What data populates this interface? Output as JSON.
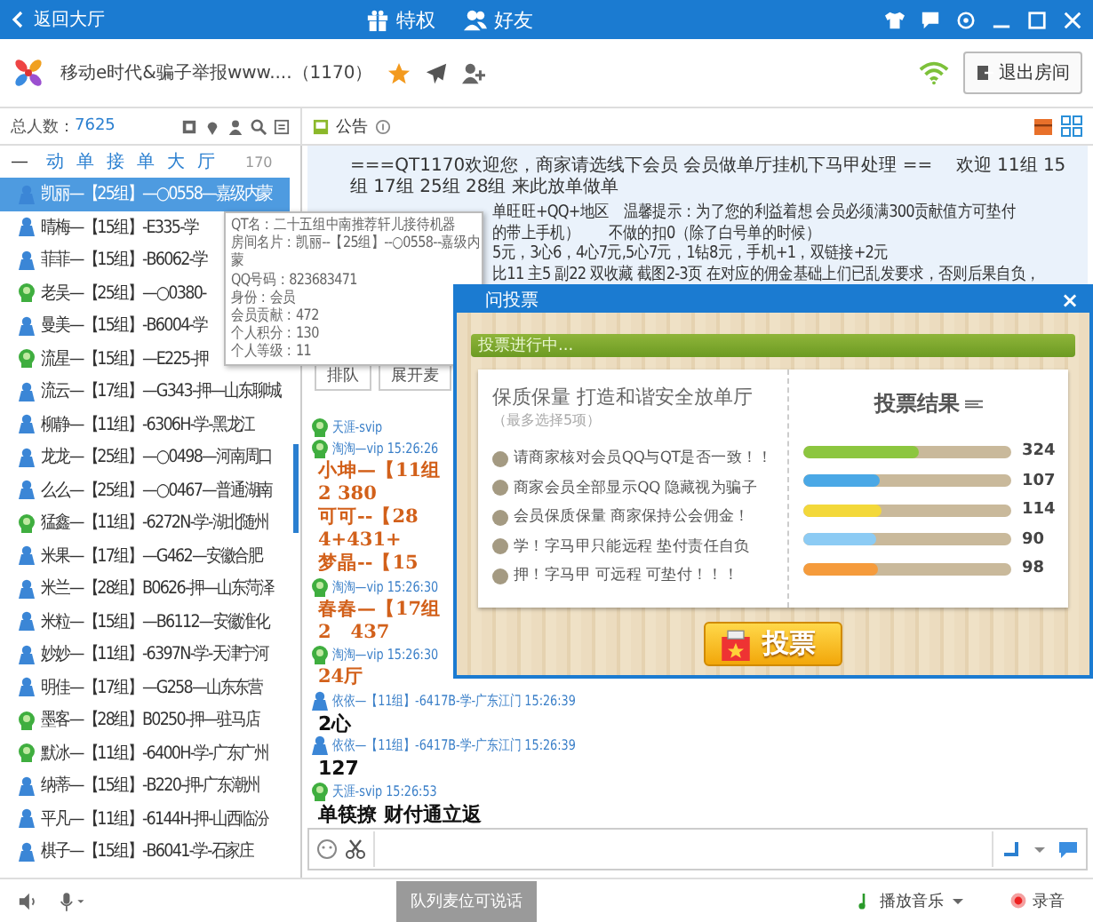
{
  "titlebar": {
    "back": "返回大厅",
    "tabs": [
      {
        "label": "特权",
        "kind": "gift"
      },
      {
        "label": "好友",
        "kind": "friends"
      }
    ]
  },
  "room": {
    "name": "移动e时代&骗子举报www....（1170）",
    "exit": "退出房间"
  },
  "info": {
    "total_label": "总人数：",
    "total": "7625",
    "notice": "公告"
  },
  "userlist": {
    "collapse": "—",
    "title": "动单接单大厅",
    "count": "170",
    "users": [
      {
        "name": "凯丽—【25组】—○0558—嘉级内蒙",
        "kind": "member",
        "selected": true
      },
      {
        "name": "晴梅—【15组】-E335-学",
        "kind": "member",
        "selected": false
      },
      {
        "name": "菲菲—【15组】-B6062-学",
        "kind": "member",
        "selected": false
      },
      {
        "name": "老吴—【25组】—○0380-",
        "kind": "vip",
        "selected": false
      },
      {
        "name": "曼美—【15组】-B6004-学",
        "kind": "member",
        "selected": false
      },
      {
        "name": "流星—【15组】—E225-押",
        "kind": "vip",
        "selected": false
      },
      {
        "name": "流云—【17组】—G343-押—山东聊城",
        "kind": "member",
        "selected": false
      },
      {
        "name": "柳静—【11组】-6306H-学-黑龙江",
        "kind": "member",
        "selected": false
      },
      {
        "name": "龙龙—【25组】—○0498—河南周口",
        "kind": "member",
        "selected": false
      },
      {
        "name": "么么—【25组】—○0467—普通湖南",
        "kind": "member",
        "selected": false
      },
      {
        "name": "猛鑫—【11组】-6272N-学-湖北随州",
        "kind": "vip",
        "selected": false
      },
      {
        "name": "米果—【17组】—G462—安徽合肥",
        "kind": "member",
        "selected": false
      },
      {
        "name": "米兰—【28组】B0626-押—山东菏泽",
        "kind": "member",
        "selected": false
      },
      {
        "name": "米粒—【15组】—B6112—安徽淮化",
        "kind": "member",
        "selected": false
      },
      {
        "name": "妙妙—【11组】-6397N-学-天津宁河",
        "kind": "member",
        "selected": false
      },
      {
        "name": "明佳—【17组】—G258—山东东营",
        "kind": "member",
        "selected": false
      },
      {
        "name": "墨客—【28组】B0250-押—驻马店",
        "kind": "vip",
        "selected": false
      },
      {
        "name": "默冰—【11组】-6400H-学-广东广州",
        "kind": "vip",
        "selected": false
      },
      {
        "name": "纳蒂—【15组】-B220-押-广东潮州",
        "kind": "member",
        "selected": false
      },
      {
        "name": "平凡—【11组】-6144H-押-山西临汾",
        "kind": "member",
        "selected": false
      },
      {
        "name": "棋子—【15组】-B6041-学-石家庄",
        "kind": "member",
        "selected": false
      }
    ]
  },
  "tooltip": [
    "QT名：二十五组中南推荐轩儿接待机器",
    "房间名片：凯丽--【25组】--○0558--嘉级内",
    "蒙",
    "QQ号码：823683471",
    "身份：会员",
    "会员贡献：472",
    "个人积分：130",
    "个人等级：11"
  ],
  "announcement": {
    "full": "===QT1170欢迎您，商家请选线下会员 会员做单厅挂机下马甲处理 ==　 欢迎 11组 15组 17组 25组 28组 来此放单做单",
    "partial": [
      "单旺旺+QQ+地区　温馨提示：为了您的利益着想 会员必须满300贡献值方可垫付",
      "的带上手机）　　不做的扣0（除了白号单的时候）",
      "5元，3心6，4心7元,5心7元，1钻8元，手机+1，双链接+2元",
      "比11 主5 副22 双收藏 截图2-3页 在对应的佣金基础上们已乱发要求，否则后果自负，"
    ]
  },
  "chat_buttons": [
    "排队",
    "展开麦"
  ],
  "messages": [
    {
      "sender": "天涯-svip",
      "kind": "vip"
    },
    {
      "sender": "淘淘—vip 15:26:26",
      "kind": "vip",
      "lines": [
        {
          "text": "小坤—【11组",
          "kind": "highlight"
        },
        {
          "text": "2 380",
          "kind": "highlight"
        },
        {
          "text": "可可--【28",
          "kind": "highlight"
        },
        {
          "text": "4+431+",
          "kind": "highlight"
        },
        {
          "text": "梦晶--【15",
          "kind": "highlight"
        }
      ]
    },
    {
      "sender": "淘淘—vip 15:26:30",
      "kind": "vip",
      "lines": [
        {
          "text": "春春—【17组",
          "kind": "highlight"
        },
        {
          "text": "2　437",
          "kind": "highlight"
        }
      ]
    },
    {
      "sender": "淘淘—vip 15:26:30",
      "kind": "vip",
      "lines": [
        {
          "text": "24厅",
          "kind": "highlight"
        }
      ]
    },
    {
      "sender": "依依—【11组】-6417B-学-广东江门 15:26:39",
      "kind": "member",
      "lines": [
        {
          "text": "2心",
          "kind": "plain"
        }
      ]
    },
    {
      "sender": "依依—【11组】-6417B-学-广东江门 15:26:39",
      "kind": "member",
      "lines": [
        {
          "text": "127",
          "kind": "plain"
        }
      ]
    },
    {
      "sender": "天涯-svip 15:26:53",
      "kind": "vip",
      "lines": [
        {
          "text": "单筷撩 财付通立返",
          "kind": "plain"
        }
      ]
    }
  ],
  "vote": {
    "title": "问投票",
    "close": "×",
    "status": "投票进行中...",
    "question": "保质保量 打造和谐安全放单厅",
    "hint": "（最多选择5项）",
    "results_title": "投票结果",
    "options": [
      {
        "text": "请商家核对会员QQ与QT是否一致！！",
        "selected": false,
        "level": 0.56,
        "count": "324",
        "color": "#8cc63f"
      },
      {
        "text": "商家会员全部显示QQ 隐藏视为骗子",
        "selected": false,
        "level": 0.37,
        "count": "107",
        "color": "#4aa8e6"
      },
      {
        "text": "会员保质保量 商家保持公会佣金！",
        "selected": false,
        "level": 0.38,
        "count": "114",
        "color": "#f3d83a"
      },
      {
        "text": "学！字马甲只能远程 垫付责任自负",
        "selected": false,
        "level": 0.35,
        "count": "90",
        "color": "#8ccbf4"
      },
      {
        "text": "押！字马甲 可远程 可垫付！！！",
        "selected": false,
        "level": 0.36,
        "count": "98",
        "color": "#f59b3c"
      }
    ],
    "submit": "投票"
  },
  "bottom": {
    "queue": "队列麦位可说话",
    "music": "播放音乐",
    "record": "录音"
  }
}
